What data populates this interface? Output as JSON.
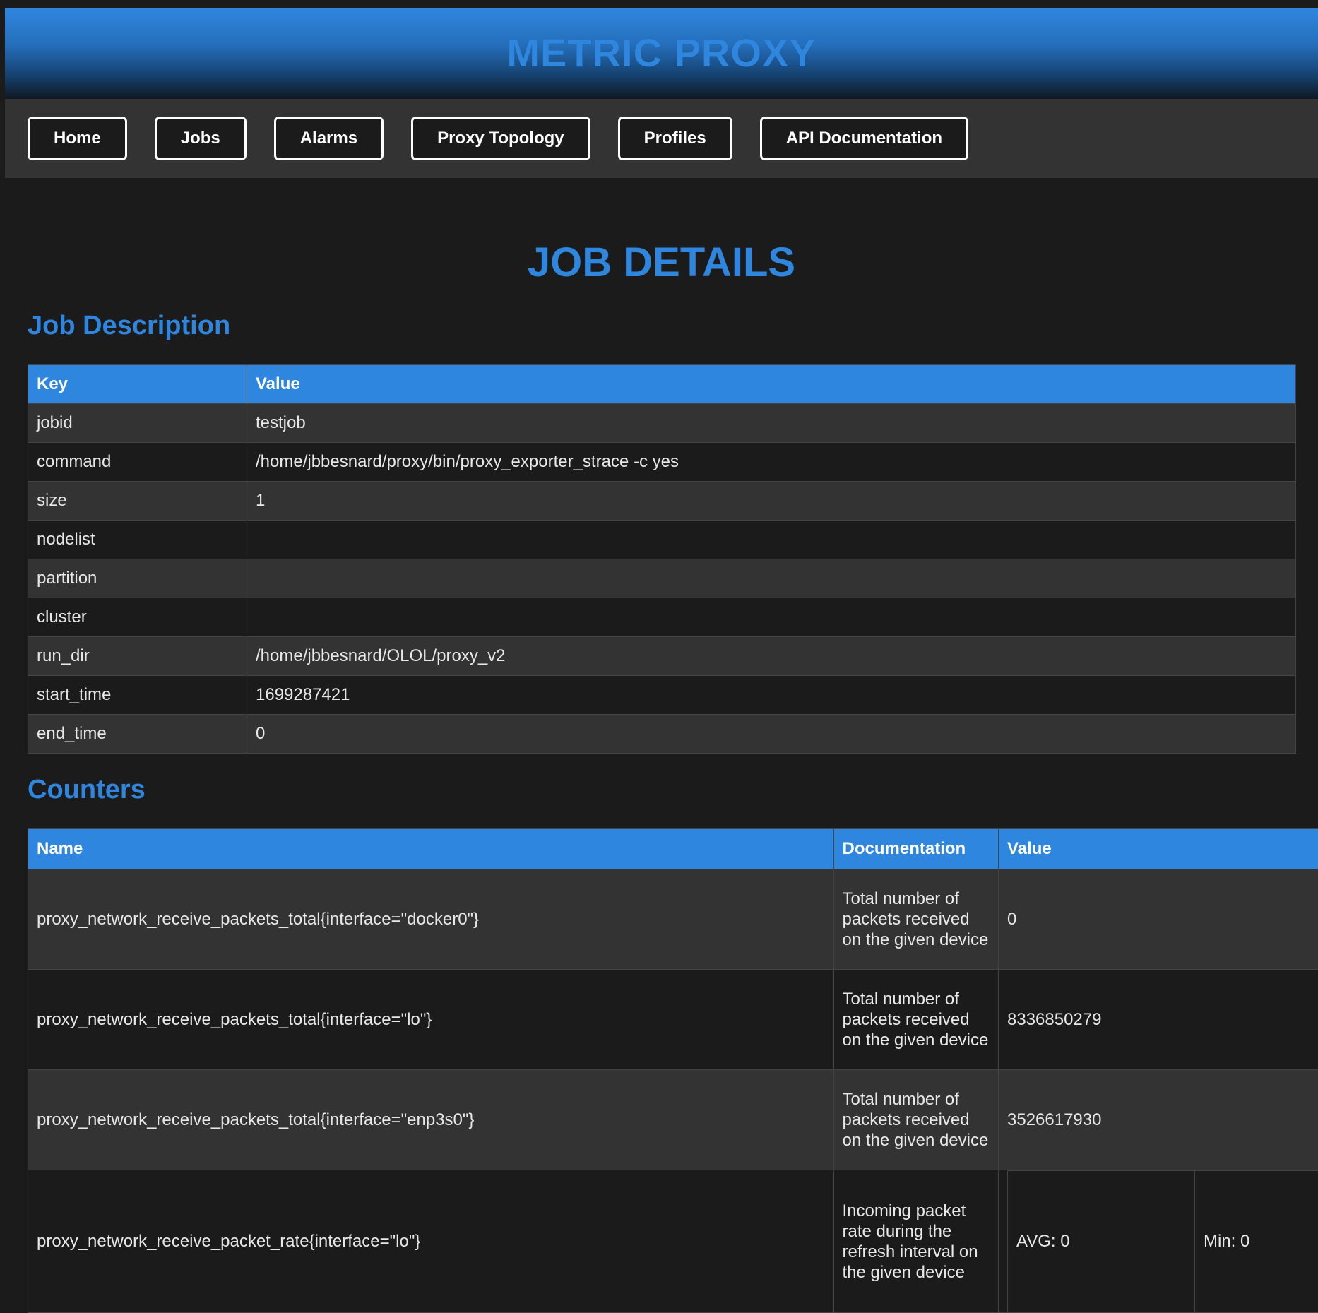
{
  "header": {
    "title": "METRIC PROXY"
  },
  "nav": {
    "items": [
      "Home",
      "Jobs",
      "Alarms",
      "Proxy Topology",
      "Profiles",
      "API Documentation"
    ]
  },
  "page_title": "JOB DETAILS",
  "job_description": {
    "heading": "Job Description",
    "columns": [
      "Key",
      "Value"
    ],
    "rows": [
      {
        "key": "jobid",
        "value": "testjob"
      },
      {
        "key": "command",
        "value": "/home/jbbesnard/proxy/bin/proxy_exporter_strace -c yes"
      },
      {
        "key": "size",
        "value": "1"
      },
      {
        "key": "nodelist",
        "value": ""
      },
      {
        "key": "partition",
        "value": ""
      },
      {
        "key": "cluster",
        "value": ""
      },
      {
        "key": "run_dir",
        "value": "/home/jbbesnard/OLOL/proxy_v2"
      },
      {
        "key": "start_time",
        "value": "1699287421"
      },
      {
        "key": "end_time",
        "value": "0"
      }
    ]
  },
  "counters": {
    "heading": "Counters",
    "columns": [
      "Name",
      "Documentation",
      "Value"
    ],
    "rows": [
      {
        "name": "proxy_network_receive_packets_total{interface=\"docker0\"}",
        "doc": "Total number of packets received on the given device",
        "value": "0"
      },
      {
        "name": "proxy_network_receive_packets_total{interface=\"lo\"}",
        "doc": "Total number of packets received on the given device",
        "value": "8336850279"
      },
      {
        "name": "proxy_network_receive_packets_total{interface=\"enp3s0\"}",
        "doc": "Total number of packets received on the given device",
        "value": "3526617930"
      },
      {
        "name": "proxy_network_receive_packet_rate{interface=\"lo\"}",
        "doc": "Incoming packet rate during the refresh interval on the given device",
        "stats": {
          "avg": "AVG: 0",
          "min": "Min: 0"
        }
      }
    ]
  },
  "colors": {
    "accent": "#2f86de",
    "background": "#1b1b1b",
    "row_alt": "#333333"
  }
}
